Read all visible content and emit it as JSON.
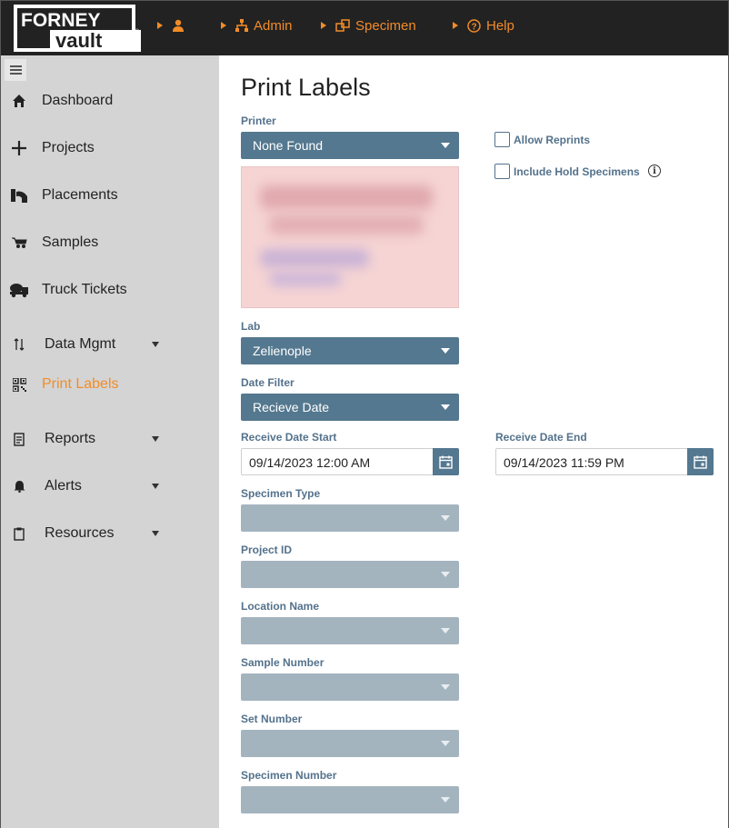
{
  "header": {
    "logo_top": "FORNEY",
    "logo_bottom": "vault",
    "nav": [
      {
        "label": "",
        "icon": "user-icon"
      },
      {
        "label": "Admin",
        "icon": "sitemap-icon"
      },
      {
        "label": "Specimen",
        "icon": "specimen-icon"
      },
      {
        "label": "Help",
        "icon": "help-icon"
      }
    ]
  },
  "sidebar": {
    "items": [
      {
        "label": "Dashboard",
        "icon": "home-icon"
      },
      {
        "label": "Projects",
        "icon": "plus-icon"
      },
      {
        "label": "Placements",
        "icon": "placement-icon"
      },
      {
        "label": "Samples",
        "icon": "wheelbarrow-icon"
      },
      {
        "label": "Truck Tickets",
        "icon": "truck-icon"
      },
      {
        "label": "Data Mgmt",
        "icon": "sort-icon"
      },
      {
        "label": "Print Labels",
        "icon": "qrcode-icon"
      },
      {
        "label": "Reports",
        "icon": "report-icon"
      },
      {
        "label": "Alerts",
        "icon": "bell-icon"
      },
      {
        "label": "Resources",
        "icon": "clipboard-icon"
      }
    ]
  },
  "main": {
    "title": "Print Labels",
    "printer": {
      "label": "Printer",
      "value": "None Found"
    },
    "allow_reprints": "Allow Reprints",
    "include_hold": "Include Hold Specimens",
    "info_glyph": "i",
    "lab": {
      "label": "Lab",
      "value": "Zelienople"
    },
    "date_filter": {
      "label": "Date Filter",
      "value": "Recieve Date"
    },
    "receive_start": {
      "label": "Receive Date Start",
      "value": "09/14/2023 12:00 AM"
    },
    "receive_end": {
      "label": "Receive Date End",
      "value": "09/14/2023 11:59 PM"
    },
    "specimen_type": {
      "label": "Specimen Type",
      "value": ""
    },
    "project_id": {
      "label": "Project ID",
      "value": ""
    },
    "location_name": {
      "label": "Location Name",
      "value": ""
    },
    "sample_number": {
      "label": "Sample Number",
      "value": ""
    },
    "set_number": {
      "label": "Set Number",
      "value": ""
    },
    "specimen_number": {
      "label": "Specimen Number",
      "value": ""
    }
  },
  "colors": {
    "accent": "#f28c28",
    "header_bg": "#222222",
    "sidebar_bg": "#d4d4d4",
    "select_bg": "#54788f",
    "select_disabled_bg": "#a4b4bf",
    "label_color": "#54728c"
  }
}
